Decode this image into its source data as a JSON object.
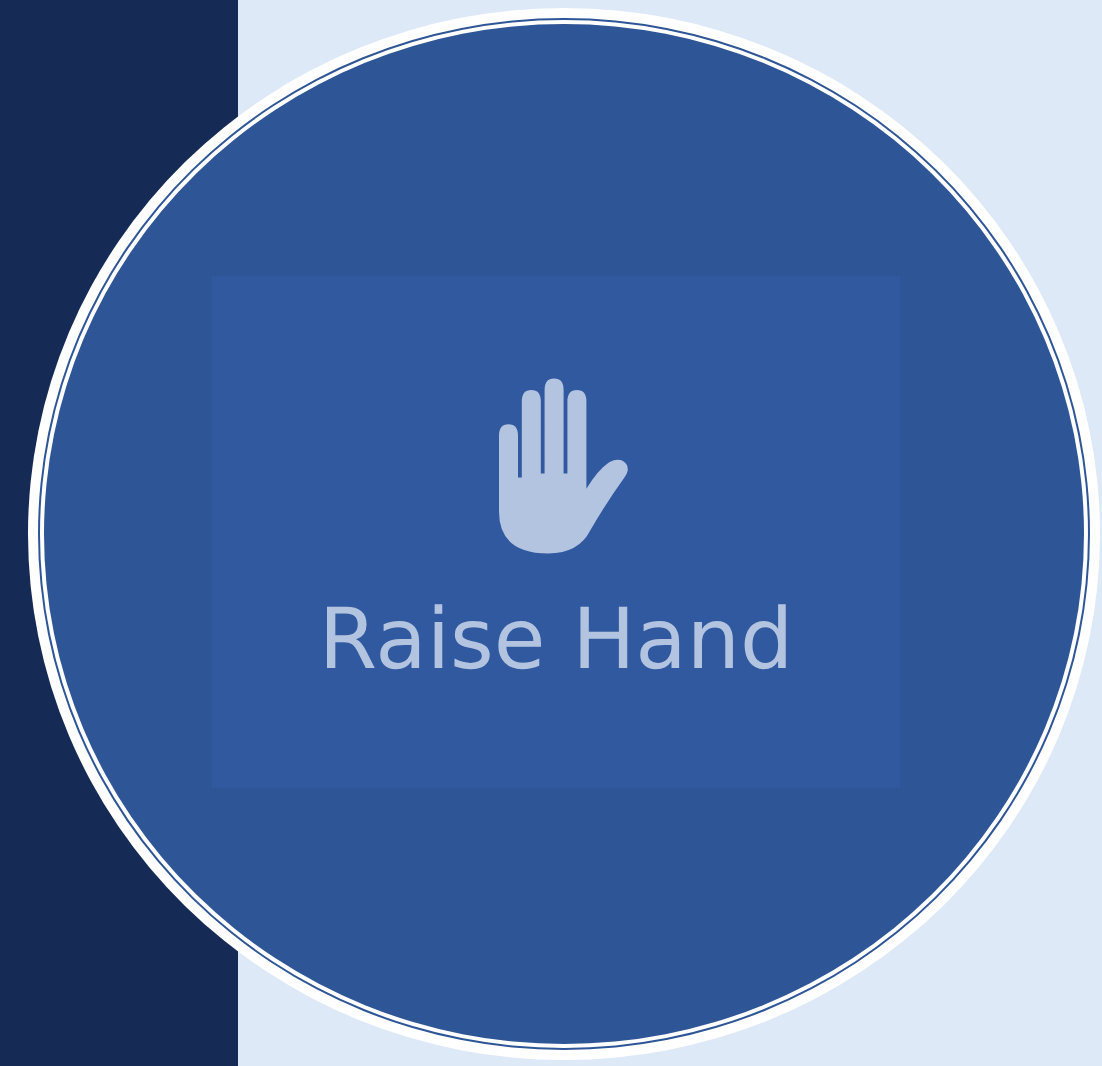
{
  "button": {
    "label": "Raise Hand"
  }
}
